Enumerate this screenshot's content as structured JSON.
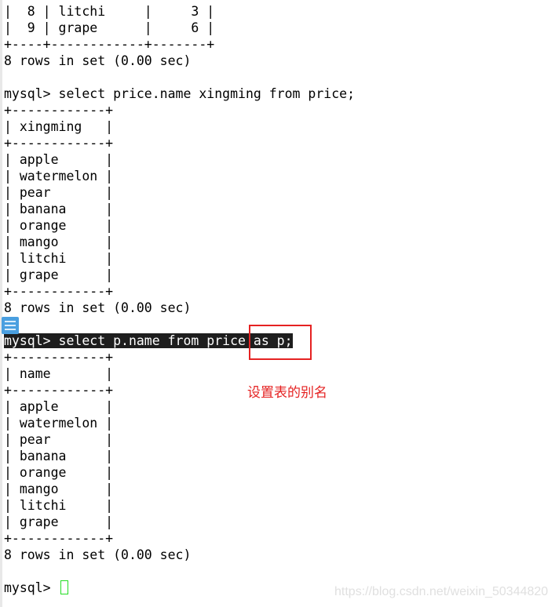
{
  "terminal": {
    "lines": [
      "|  8 | litchi     |     3 |",
      "|  9 | grape      |     6 |",
      "+----+------------+-------+",
      "8 rows in set (0.00 sec)",
      "",
      "mysql> select price.name xingming from price;",
      "+------------+",
      "| xingming   |",
      "+------------+",
      "| apple      |",
      "| watermelon |",
      "| pear       |",
      "| banana     |",
      "| orange     |",
      "| mango      |",
      "| litchi     |",
      "| grape      |",
      "+------------+",
      "8 rows in set (0.00 sec)",
      "",
      "mysql> select p.name from price as p;",
      "+------------+",
      "| name       |",
      "+------------+",
      "| apple      |",
      "| watermelon |",
      "| pear       |",
      "| banana     |",
      "| orange     |",
      "| mango      |",
      "| litchi     |",
      "| grape      |",
      "+------------+",
      "8 rows in set (0.00 sec)",
      "",
      "mysql> "
    ],
    "highlighted_line_index": 20,
    "cursor_color": "#22dd22"
  },
  "annotation": {
    "text": "设置表的别名",
    "color": "#e52222"
  },
  "watermark": "https://blog.csdn.net/weixin_50344820",
  "icons": {
    "side_menu": "menu-icon"
  }
}
